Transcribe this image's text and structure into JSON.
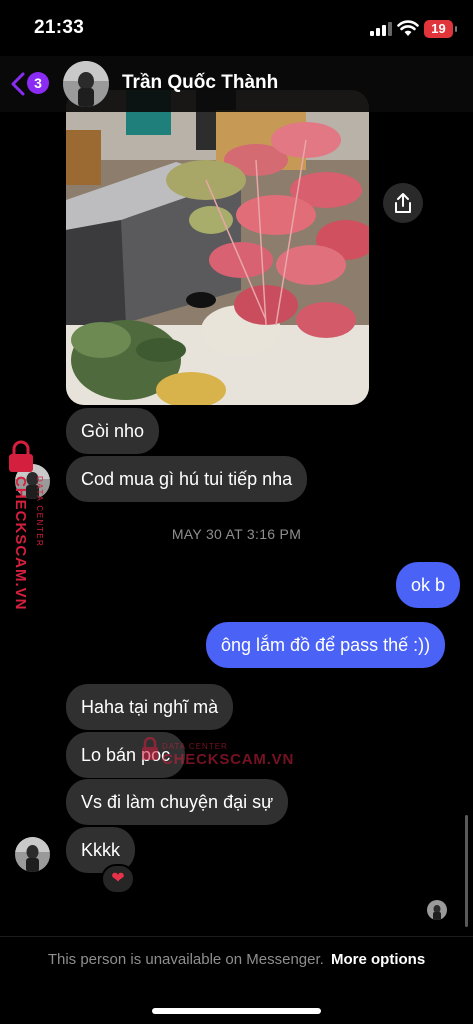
{
  "status_bar": {
    "time": "21:33",
    "battery": "19"
  },
  "header": {
    "back_badge": "3",
    "contact_name": "Trần Quốc Thành"
  },
  "messages": [
    {
      "side": "in",
      "text": "Gòi nho"
    },
    {
      "side": "in",
      "text": "Cod mua gì hú tui tiếp nha"
    },
    {
      "side": "out",
      "text": "ok b"
    },
    {
      "side": "out",
      "text": "ông lắm đồ để pass thế :))"
    },
    {
      "side": "in",
      "text": "Haha tại nghĩ mà"
    },
    {
      "side": "in",
      "text": "Lo bán poc"
    },
    {
      "side": "in",
      "text": "Vs đi làm chuyện đại sự"
    },
    {
      "side": "in",
      "text": "Kkkk"
    }
  ],
  "timestamp": "MAY 30 AT 3:16 PM",
  "reaction": "❤",
  "footer": {
    "note": "This person is unavailable on Messenger.",
    "more_options": "More options"
  },
  "watermark": {
    "side_text": "CHECKSCAM.VN",
    "side_small": "DATA CENTER",
    "center_small": "DATA CENTER",
    "center_text": "CHECKSCAM.VN"
  },
  "colors": {
    "incoming_bubble": "#303030",
    "outgoing_bubble": "#4a62f5",
    "badge": "#8b2cf5",
    "battery_low": "#e0353a",
    "watermark": "#d41f3e"
  },
  "icons": [
    "back-chevron-icon",
    "share-icon",
    "signal-icon",
    "wifi-icon",
    "battery-icon",
    "heart-icon"
  ]
}
